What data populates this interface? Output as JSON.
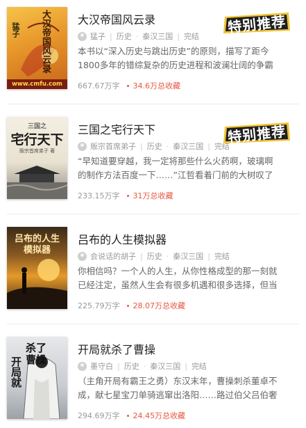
{
  "books": [
    {
      "title": "大汉帝国风云录",
      "author": "猛子",
      "category": "历史",
      "subcategory": "秦汉三国",
      "status": "完结",
      "description": "本书以“深入历史与跳出历史”的原则，描写了距今1800多年的错综复杂的历史进程和波澜壮阔的争霸战争。小",
      "word_count": "667.67万字",
      "favorites": "34.6万总收藏",
      "badge": "特别推荐",
      "cover": {
        "title": "大汉帝国风云录",
        "author": "猛子",
        "site": "www.cmfu.com"
      }
    },
    {
      "title": "三国之宅行天下",
      "author": "贩宗首席弟子",
      "category": "历史",
      "subcategory": "秦汉三国",
      "status": "完结",
      "description": "“早知道要穿越，我一定将那些什么火药啊，玻璃啊的制作方法百度一下……”江哲看着门前的大树叹了口",
      "word_count": "233.15万字",
      "favorites": "31万总收藏",
      "badge": "特别推荐",
      "cover": {
        "title": "宅行天下",
        "subtitle": "三国之",
        "author": "贩宗首席弟子 著"
      }
    },
    {
      "title": "吕布的人生模拟器",
      "author": "会说话的胡子",
      "category": "历史",
      "subcategory": "秦汉三国",
      "status": "完结",
      "description": "你相信吗？一个人的人生，从你性格成型的那一刻就已经注定，虽然人生会有很多机遇和很多选择，但当你面",
      "word_count": "225.79万字",
      "favorites": "28.07万总收藏",
      "cover": {
        "title": "吕布的人生模拟器"
      }
    },
    {
      "title": "开局就杀了曹操",
      "author": "墨守白",
      "category": "历史",
      "subcategory": "秦汉三国",
      "status": "完结",
      "description": "（主角开局有霸王之勇）东汉末年，曹操刺杀董卓不成，献七星宝刀单骑逃窜出洛阳……路过伯父吕伯奢",
      "word_count": "294.69万字",
      "favorites": "24.45万总收藏",
      "cover": {
        "title_left": "开局就",
        "title_right": "杀了曹操"
      }
    }
  ],
  "colors": {
    "accent": "#e8563f",
    "badge_fill": "#1e1e1e",
    "badge_outline": "#f2c230"
  }
}
